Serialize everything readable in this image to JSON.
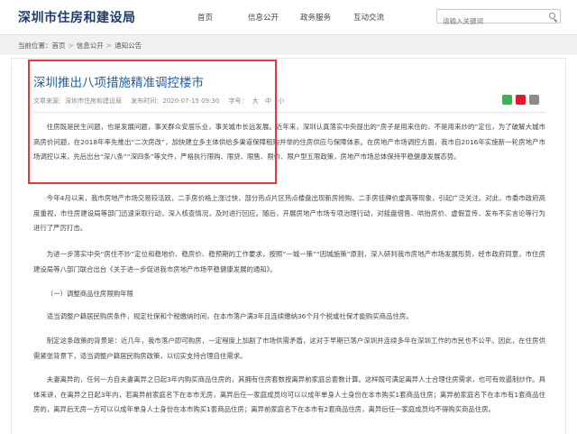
{
  "header": {
    "site_title": "深圳市住房和建设局",
    "nav": [
      "首页",
      "信息公开",
      "政务服务",
      "互动交流"
    ],
    "search_placeholder": "请输入关键词"
  },
  "breadcrumb": {
    "label": "当前位置：",
    "items": [
      "首页",
      "信息公开",
      "通知公告"
    ]
  },
  "article": {
    "title": "深圳推出八项措施精准调控楼市",
    "source": "文章来源：深圳市住房和建设局",
    "date": "发布时间：2020-07-15 09:30",
    "font_label": "字号：",
    "font_sizes": [
      "大",
      "中",
      "小"
    ],
    "paragraphs": [
      "住房既是民生问题，也是发展问题，事关群众安居乐业，事关城市长远发展。近年来，深圳认真落实中央提出的“房子是用来住的、不是用来炒的”定位，为了破解大城市高房价问题，在2018年率先推出“二次房改”，加快建立多主体供给多渠道保障租购并举的住房供应与保障体系。在房地产市场调控方面，我市自2016年实施新一轮房地产市场调控以来，先后出台“深八条”“深四条”等文件，严格执行限购、限贷、限售、限价、限户型五限政策，房地产市场总体保持平稳健康发展态势。",
      "今年4月以来，我市房地产市场交易较活跃，二手房价格上涨过快，部分热点片区热点楼盘出现新房抢购、二手房挂牌价虚高等现象，引起广泛关注。对此，市委市政府高度重视，市住房建设局等部门迅速采取行动，深入核查情况，及时进行回应。随后，开展房地产市场专项治理行动，对摇盘借售、哄抬房价、虚假宣传、发布不实言论等行为进行了严厉打击。",
      "为进一步落实中央“房住不炒”定位和稳地价、稳房价、稳预期的工作要求，按照“一城一策”“因城施策”原则，深入研判我市房地产市场发展形势，经市政府同意，市住房建设局等八部门联合出台《关于进一步促进我市房地产市场平稳健康发展的通知》。",
      "（一）调整商品住房限购年限",
      "适当调整户籍居民购房条件，规定社保和个税缴纳时间，在本市落户满3年且连续缴纳36个月个税或社保才能购买商品住房。",
      "制定这条政策的背景是：近几年，我市落户即可购房，一定程度上加剧了市场供需矛盾，这对于早期已落户深圳并连续多年在深圳工作的市民也不公平。因此，在住房供需紧张背景下，适当调整户籍居民购房政策，以切实支持合理自住需求。",
      "夫妻离异的，任何一方自夫妻离异之日起3年内购买商品住房的，其拥有住房套数按离异前家庭总套数计算。这样既可满足离异人士合理住房需求，也可有效遏制炒作。具体来讲，在离异之日起3年内，若离异前家庭名下在本市无房，离异后任一家庭成员均可以以成年单身人士身份在本市购买1套商品住房；离异前家庭名下在本市有1套商品住房的，离异后无房一方可以以成年单身人士身份在本市购买1套商品住房；离异前家庭名下在本市有2套商品住房，离异后任一家庭成员均不得购买商品住房。"
    ]
  },
  "colors": {
    "brand": "#1f3a6b",
    "title": "#1f5fa8",
    "highlight_border": "#e53935"
  }
}
